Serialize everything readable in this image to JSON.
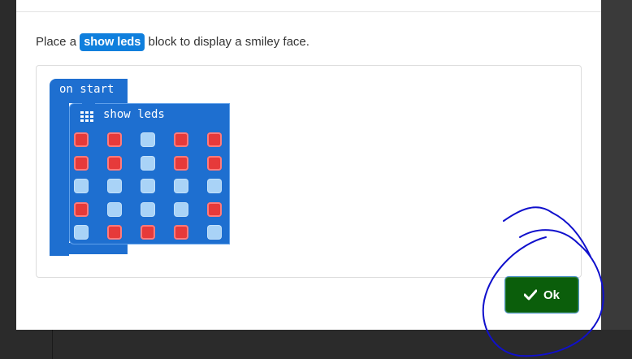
{
  "dialog": {
    "instruction_prefix": "Place a",
    "instruction_chip": "show leds",
    "instruction_suffix": "block to display a smiley face.",
    "ok_label": "Ok"
  },
  "blocks": {
    "on_start_label": "on start",
    "show_leds_label": "show leds",
    "leds": [
      [
        1,
        1,
        0,
        1,
        1
      ],
      [
        1,
        1,
        0,
        1,
        1
      ],
      [
        0,
        0,
        0,
        0,
        0
      ],
      [
        1,
        0,
        0,
        0,
        1
      ],
      [
        0,
        1,
        1,
        1,
        0
      ]
    ]
  },
  "colors": {
    "block_blue": "#1e6fd0",
    "led_on": "#e63a3a",
    "led_off": "#a9d3f7",
    "ok_green": "#0b5e0b",
    "annotation_ink": "#1010cc"
  },
  "icons": {
    "grid": "grid-icon",
    "check": "check-icon"
  }
}
